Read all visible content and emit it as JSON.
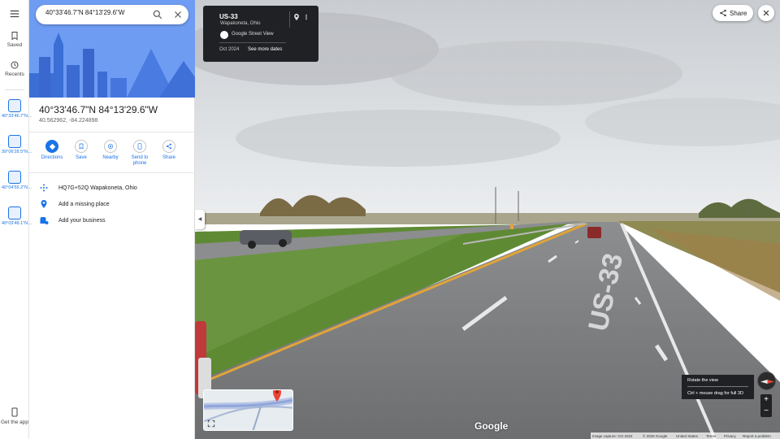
{
  "search": {
    "value": "40°33'46.7\"N 84°13'29.6\"W"
  },
  "rail": {
    "saved": "Saved",
    "recents": "Recents",
    "get_app": "Get the app",
    "recent_items": [
      "40°33'46.7\"N…",
      "39°06'28.5\"N…",
      "40°04'55.2\"N…",
      "40°03'48.1\"N…"
    ]
  },
  "place": {
    "title": "40°33'46.7\"N 84°13'29.6\"W",
    "coords": "40.562962, -84.224898",
    "actions": [
      "Directions",
      "Save",
      "Nearby",
      "Send to phone",
      "Share"
    ],
    "rows": [
      {
        "icon": "plus-code-icon",
        "label": "HQ7G+52Q Wapakoneta, Ohio"
      },
      {
        "icon": "add-place-icon",
        "label": "Add a missing place"
      },
      {
        "icon": "business-icon",
        "label": "Add your business"
      }
    ]
  },
  "street_card": {
    "road": "US-33",
    "location": "Wapakoneta, Ohio",
    "source": "Google Street View",
    "date": "Oct 2024",
    "more_dates": "See more dates"
  },
  "share_label": "Share",
  "tooltip": {
    "line1": "Rotate the view",
    "line2": "Ctrl + mouse drag for full 3D"
  },
  "logo": "Google",
  "footer": {
    "capture": "Image capture: Oct 2024",
    "copyright": "© 2025 Google",
    "country": "United States",
    "terms": "Terms",
    "privacy": "Privacy",
    "report": "Report a problem"
  },
  "road_marking": "US-33",
  "colors": {
    "accent": "#1a73e8",
    "hero": "#6e9bf2",
    "card": "#202124",
    "pin": "#ea4335"
  }
}
